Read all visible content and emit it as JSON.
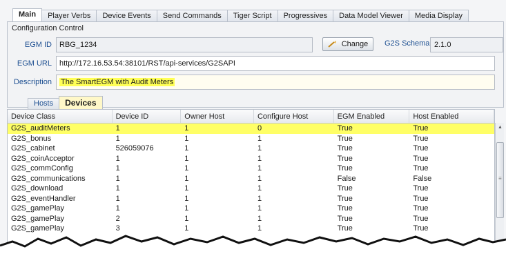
{
  "tabs": [
    {
      "label": "Main",
      "active": true
    },
    {
      "label": "Player Verbs",
      "active": false
    },
    {
      "label": "Device Events",
      "active": false
    },
    {
      "label": "Send Commands",
      "active": false
    },
    {
      "label": "Tiger Script",
      "active": false
    },
    {
      "label": "Progressives",
      "active": false
    },
    {
      "label": "Data Model Viewer",
      "active": false
    },
    {
      "label": "Media Display",
      "active": false
    }
  ],
  "config": {
    "section_title": "Configuration Control",
    "egm_id_label": "EGM ID",
    "egm_id_value": "RBG_1234",
    "change_label": "Change",
    "schema_label": "G2S Schema",
    "schema_value": "2.1.0",
    "egm_url_label": "EGM URL",
    "egm_url_value": "http://172.16.53.54:38101/RST/api-services/G2SAPI",
    "description_label": "Description",
    "description_value": "The SmartEGM with Audit Meters"
  },
  "subtabs": [
    {
      "label": "Hosts",
      "active": false
    },
    {
      "label": "Devices",
      "active": true
    }
  ],
  "table": {
    "columns": [
      "Device Class",
      "Device ID",
      "Owner Host",
      "Configure Host",
      "EGM Enabled",
      "Host Enabled"
    ],
    "rows": [
      [
        "G2S_auditMeters",
        "1",
        "1",
        "0",
        "True",
        "True"
      ],
      [
        "G2S_bonus",
        "1",
        "1",
        "1",
        "True",
        "True"
      ],
      [
        "G2S_cabinet",
        "526059076",
        "1",
        "1",
        "True",
        "True"
      ],
      [
        "G2S_coinAcceptor",
        "1",
        "1",
        "1",
        "True",
        "True"
      ],
      [
        "G2S_commConfig",
        "1",
        "1",
        "1",
        "True",
        "True"
      ],
      [
        "G2S_communications",
        "1",
        "1",
        "1",
        "False",
        "False"
      ],
      [
        "G2S_download",
        "1",
        "1",
        "1",
        "True",
        "True"
      ],
      [
        "G2S_eventHandler",
        "1",
        "1",
        "1",
        "True",
        "True"
      ],
      [
        "G2S_gamePlay",
        "1",
        "1",
        "1",
        "True",
        "True"
      ],
      [
        "G2S_gamePlay",
        "2",
        "1",
        "1",
        "True",
        "True"
      ],
      [
        "G2S_gamePlay",
        "3",
        "1",
        "1",
        "True",
        "True"
      ]
    ],
    "selected_row": 0
  },
  "icons": {
    "change": "arrow-edit-icon",
    "scroll_up": "scroll-up-arrow-icon",
    "thumb_grip": "scroll-grip-icon"
  },
  "colors": {
    "highlight": "#ffff66",
    "label_blue": "#1d4f91"
  }
}
